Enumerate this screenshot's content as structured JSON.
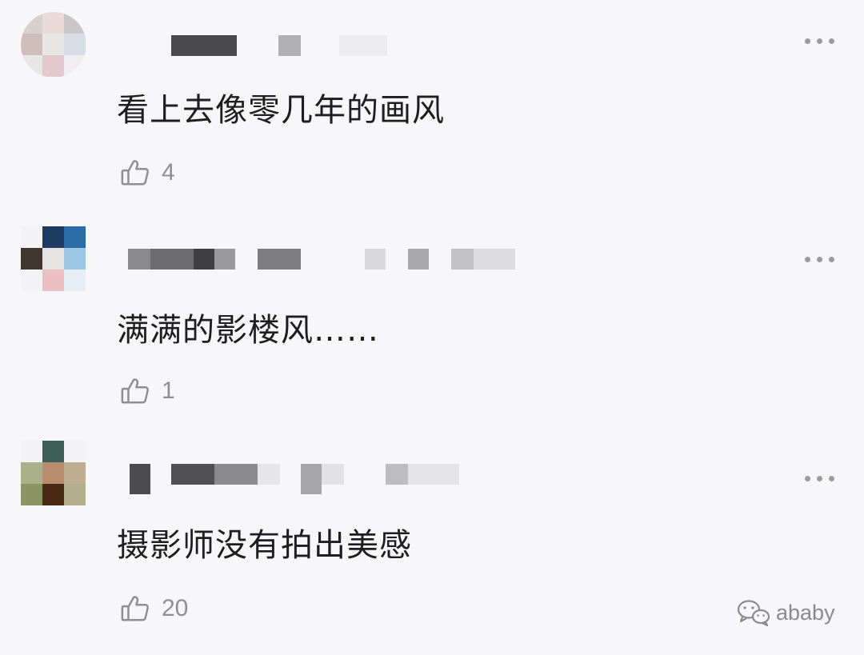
{
  "comments": [
    {
      "text": "看上去像零几年的画风",
      "likes": "4"
    },
    {
      "text": "满满的影楼风……",
      "likes": "1"
    },
    {
      "text": "摄影师没有拍出美感",
      "likes": "20"
    }
  ],
  "watermark": {
    "label": "ababy",
    "icon": "wechat-icon"
  },
  "icons": {
    "like": "thumbs-up-icon",
    "more": "more-dots-icon"
  }
}
